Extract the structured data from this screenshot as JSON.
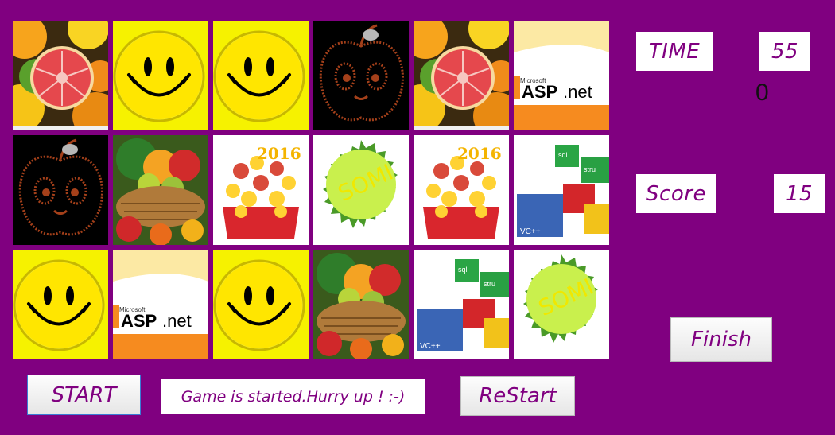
{
  "game": {
    "background_color": "#800080",
    "accent_color": "#800080",
    "grid": {
      "rows": 3,
      "cols": 6,
      "cards": [
        [
          "citrus-fruits",
          "smiley",
          "smiley",
          "cartoon-apple",
          "citrus-fruits",
          "aspnet-logo"
        ],
        [
          "cartoon-apple",
          "fruit-basket",
          "fruit-arrangement-2016",
          "somi-badge",
          "fruit-arrangement-2016",
          "code-cubes"
        ],
        [
          "smiley",
          "aspnet-logo",
          "smiley",
          "fruit-basket",
          "code-cubes",
          "somi-badge"
        ]
      ]
    },
    "card_text": {
      "microsoft": "Microsoft",
      "asp": "ASP",
      "net": ".net",
      "year": "2016",
      "somi": "SOMI",
      "sql": "sql",
      "stru": "stru",
      "vcpp": "VC++"
    },
    "time_label": "TIME",
    "time_value": "55",
    "counter_value": "0",
    "score_label": "Score",
    "score_value": "15",
    "finish_label": "Finish",
    "start_label": "START",
    "status_message": "Game is started.Hurry up ! :-)",
    "restart_label": "ReStart"
  }
}
